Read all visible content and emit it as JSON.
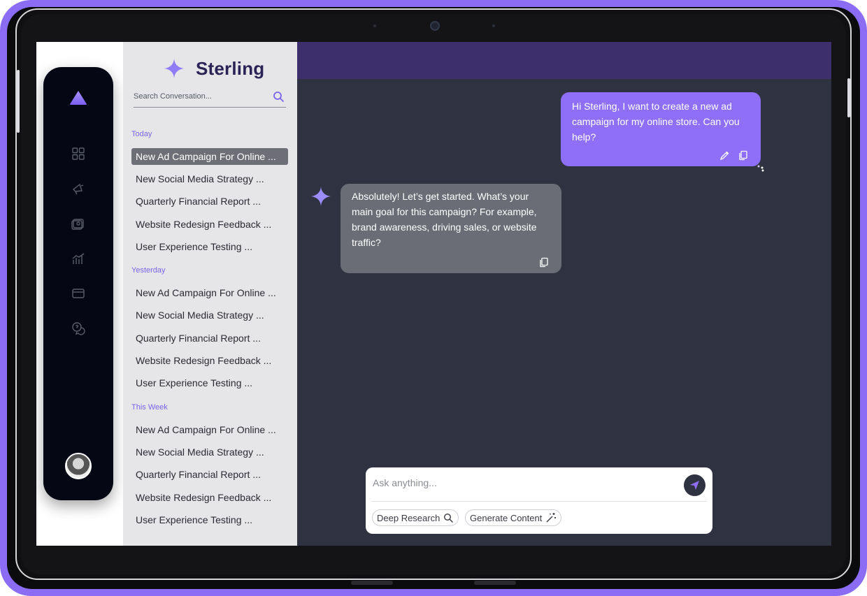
{
  "app": {
    "name": "Sterling",
    "accent_color": "#8f6ff7",
    "header_color": "#3c2f6c"
  },
  "rail": {
    "logo_icon": "triangle-logo-icon",
    "items": [
      {
        "icon": "dashboard-grid-icon"
      },
      {
        "icon": "megaphone-icon"
      },
      {
        "icon": "media-gallery-icon"
      },
      {
        "icon": "analytics-chart-icon"
      },
      {
        "icon": "credit-card-icon"
      },
      {
        "icon": "help-chat-icon"
      }
    ],
    "avatar_icon": "user-avatar"
  },
  "sidebar": {
    "search_placeholder": "Search Conversation...",
    "sections": [
      {
        "label": "Today",
        "items": [
          "New Ad Campaign For Online ...",
          "New Social Media Strategy ...",
          "Quarterly Financial Report ...",
          "Website Redesign Feedback ...",
          "User Experience Testing ..."
        ]
      },
      {
        "label": "Yesterday",
        "items": [
          "New Ad Campaign For Online ...",
          "New Social Media Strategy ...",
          "Quarterly Financial Report ...",
          "Website Redesign Feedback ...",
          "User Experience Testing ..."
        ]
      },
      {
        "label": "This Week",
        "items": [
          "New Ad Campaign For Online ...",
          "New Social Media Strategy ...",
          "Quarterly Financial Report ...",
          "Website Redesign Feedback ...",
          "User Experience Testing ..."
        ]
      }
    ]
  },
  "chat": {
    "messages": [
      {
        "role": "user",
        "text": "Hi Sterling, I want to create a new ad campaign for my online store. Can you help?"
      },
      {
        "role": "assistant",
        "text": "Absolutely! Let’s get started. What’s your main goal for this campaign? For example, brand awareness, driving sales, or website traffic?"
      }
    ]
  },
  "composer": {
    "placeholder": "Ask anything...",
    "chips": [
      "Deep Research",
      "Generate Content"
    ]
  }
}
